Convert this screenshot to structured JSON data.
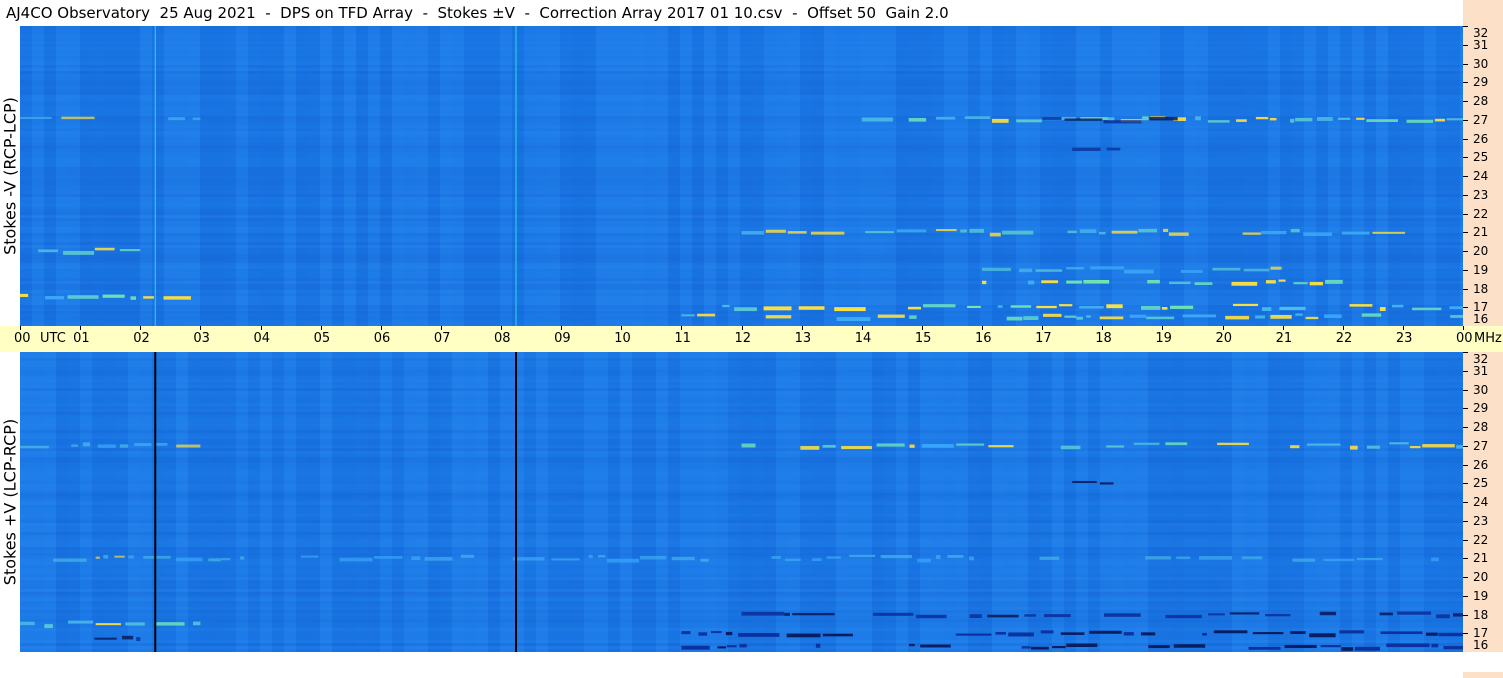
{
  "title": {
    "observatory": "AJ4CO Observatory",
    "date": "25 Aug 2021",
    "sep1": "-",
    "instrument": "DPS on TFD Array",
    "sep2": "-",
    "mode": "Stokes ±V",
    "sep3": "-",
    "correction": "Correction Array 2017 01 10.csv",
    "sep4": "-",
    "offset": "Offset 50",
    "gain": "Gain 2.0"
  },
  "colors": {
    "background": "#ffffff",
    "time_axis_bg": "#ffffc4",
    "freq_axis_bg": "#fde0c8",
    "spectrogram_base": "#1a78e6",
    "spectrogram_dark": "#0a2f9c",
    "spectrogram_bright": "#7df0a0",
    "spectrogram_hot": "#ffe040"
  },
  "chart_data": [
    {
      "type": "heatmap",
      "title": "",
      "ylabel": "Stokes -V  (RCP-LCP)",
      "ylim": [
        16,
        32
      ],
      "yunit": "MHz",
      "y_ticks": [
        "16",
        "17",
        "18",
        "19",
        "20",
        "21",
        "22",
        "23",
        "24",
        "25",
        "26",
        "27",
        "28",
        "29",
        "30",
        "31",
        "32"
      ],
      "xlim": [
        0,
        24
      ],
      "x_ticks": [
        "00",
        "01",
        "02",
        "03",
        "04",
        "05",
        "06",
        "07",
        "08",
        "09",
        "10",
        "11",
        "12",
        "13",
        "14",
        "15",
        "16",
        "17",
        "18",
        "19",
        "20",
        "21",
        "22",
        "23",
        "00"
      ],
      "xunit": "UTC",
      "vertical_markers_utc": [
        2.25,
        8.25
      ],
      "marker_color": "#27c8e8",
      "bright_bands": [
        {
          "mhz": 27.0,
          "from_utc": 0,
          "to_utc": 3,
          "level": 0.4
        },
        {
          "mhz": 27.0,
          "from_utc": 14,
          "to_utc": 24,
          "level": 0.8
        },
        {
          "mhz": 21.0,
          "from_utc": 12,
          "to_utc": 24,
          "level": 0.6
        },
        {
          "mhz": 20.0,
          "from_utc": 0.3,
          "to_utc": 2,
          "level": 0.7
        },
        {
          "mhz": 17.6,
          "from_utc": 0,
          "to_utc": 3,
          "level": 0.9
        },
        {
          "mhz": 17.0,
          "from_utc": 11,
          "to_utc": 24,
          "level": 0.95
        },
        {
          "mhz": 16.5,
          "from_utc": 11,
          "to_utc": 24,
          "level": 0.8
        },
        {
          "mhz": 18.3,
          "from_utc": 16,
          "to_utc": 22,
          "level": 0.9
        },
        {
          "mhz": 19.0,
          "from_utc": 16,
          "to_utc": 21,
          "level": 0.5
        }
      ],
      "dark_bands": [
        {
          "mhz": 27.0,
          "from_utc": 17,
          "to_utc": 20,
          "level": 0.6
        },
        {
          "mhz": 25.5,
          "from_utc": 17.5,
          "to_utc": 18.3,
          "level": 0.5
        }
      ]
    },
    {
      "type": "heatmap",
      "title": "",
      "ylabel": "Stokes +V  (LCP-RCP)",
      "ylim": [
        16,
        32
      ],
      "yunit": "",
      "y_ticks": [
        "16",
        "17",
        "18",
        "19",
        "20",
        "21",
        "22",
        "23",
        "24",
        "25",
        "26",
        "27",
        "28",
        "29",
        "30",
        "31",
        "32"
      ],
      "xlim": [
        0,
        24
      ],
      "vertical_markers_utc": [
        2.25,
        8.25
      ],
      "marker_color": "#000000",
      "bright_bands": [
        {
          "mhz": 27.0,
          "from_utc": 12,
          "to_utc": 24,
          "level": 0.75
        },
        {
          "mhz": 27.0,
          "from_utc": 0,
          "to_utc": 3,
          "level": 0.4
        },
        {
          "mhz": 17.5,
          "from_utc": 0,
          "to_utc": 3,
          "level": 0.85
        },
        {
          "mhz": 21.0,
          "from_utc": 0,
          "to_utc": 24,
          "level": 0.3
        }
      ],
      "dark_bands": [
        {
          "mhz": 17.0,
          "from_utc": 11,
          "to_utc": 24,
          "level": 0.9
        },
        {
          "mhz": 16.3,
          "from_utc": 11,
          "to_utc": 24,
          "level": 0.9
        },
        {
          "mhz": 18.0,
          "from_utc": 12,
          "to_utc": 24,
          "level": 0.7
        },
        {
          "mhz": 25.0,
          "from_utc": 17.5,
          "to_utc": 18.2,
          "level": 0.7
        },
        {
          "mhz": 16.8,
          "from_utc": 0,
          "to_utc": 2,
          "level": 0.6
        }
      ]
    }
  ]
}
